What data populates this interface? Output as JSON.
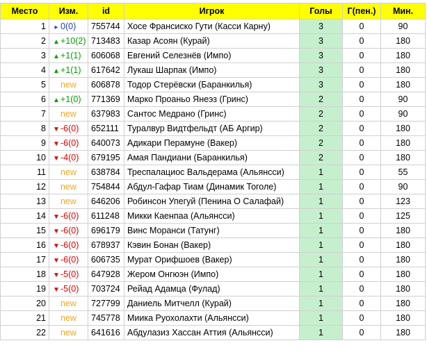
{
  "headers": {
    "rank": "Место",
    "change": "Изм.",
    "id": "id",
    "player": "Игрок",
    "goals": "Голы",
    "pen": "Г(пен.)",
    "min": "Мин."
  },
  "colors": {
    "header_bg": "#ffff00",
    "goals_bg": "#c6efce",
    "up": "#00a000",
    "down": "#e00000",
    "same": "#1f3fbf",
    "new": "#f5a623"
  },
  "rows": [
    {
      "rank": "1",
      "change_type": "same",
      "change": "0(0)",
      "id": "755744",
      "player": "Хосе Франсиско Гути (Касси Карну)",
      "goals": "3",
      "pen": "0",
      "min": "90"
    },
    {
      "rank": "2",
      "change_type": "up",
      "change": "+10(2)",
      "id": "713483",
      "player": "Казар Асоян (Курай)",
      "goals": "3",
      "pen": "0",
      "min": "180"
    },
    {
      "rank": "3",
      "change_type": "up",
      "change": "+1(1)",
      "id": "606068",
      "player": "Евгений Селезнёв (Импо)",
      "goals": "3",
      "pen": "0",
      "min": "180"
    },
    {
      "rank": "4",
      "change_type": "up",
      "change": "+1(1)",
      "id": "617642",
      "player": "Лукаш Шарпак (Импо)",
      "goals": "3",
      "pen": "0",
      "min": "180"
    },
    {
      "rank": "5",
      "change_type": "new",
      "change": "new",
      "id": "606878",
      "player": "Тодор Стерёвски (Баранкилья)",
      "goals": "3",
      "pen": "0",
      "min": "180"
    },
    {
      "rank": "6",
      "change_type": "up",
      "change": "+1(0)",
      "id": "771369",
      "player": "Марко Проаньо Янеэз (Гринс)",
      "goals": "2",
      "pen": "0",
      "min": "90"
    },
    {
      "rank": "7",
      "change_type": "new",
      "change": "new",
      "id": "637983",
      "player": "Сантос Медрано (Гринс)",
      "goals": "2",
      "pen": "0",
      "min": "90"
    },
    {
      "rank": "8",
      "change_type": "down",
      "change": "-6(0)",
      "id": "652111",
      "player": "Туралвур Видтфельдт (АБ Аргир)",
      "goals": "2",
      "pen": "0",
      "min": "180"
    },
    {
      "rank": "9",
      "change_type": "down",
      "change": "-6(0)",
      "id": "640073",
      "player": "Адикари Перамуне (Вакер)",
      "goals": "2",
      "pen": "0",
      "min": "180"
    },
    {
      "rank": "10",
      "change_type": "down",
      "change": "-4(0)",
      "id": "679195",
      "player": "Амая Пандиани (Баранкилья)",
      "goals": "2",
      "pen": "0",
      "min": "180"
    },
    {
      "rank": "11",
      "change_type": "new",
      "change": "new",
      "id": "638784",
      "player": "Треспалациос Вальдерама (Альянсси)",
      "goals": "1",
      "pen": "0",
      "min": "55"
    },
    {
      "rank": "12",
      "change_type": "new",
      "change": "new",
      "id": "754844",
      "player": "Абдул-Гафар Тиам (Динамик Тоголе)",
      "goals": "1",
      "pen": "0",
      "min": "90"
    },
    {
      "rank": "13",
      "change_type": "new",
      "change": "new",
      "id": "646206",
      "player": "Робинсон Упегуй (Пенина О Салафай)",
      "goals": "1",
      "pen": "0",
      "min": "123"
    },
    {
      "rank": "14",
      "change_type": "down",
      "change": "-6(0)",
      "id": "611248",
      "player": "Микки Каенпаа (Альянсси)",
      "goals": "1",
      "pen": "0",
      "min": "125"
    },
    {
      "rank": "15",
      "change_type": "down",
      "change": "-6(0)",
      "id": "696179",
      "player": "Винс Моранси (Татунг)",
      "goals": "1",
      "pen": "0",
      "min": "180"
    },
    {
      "rank": "16",
      "change_type": "down",
      "change": "-6(0)",
      "id": "678937",
      "player": "Кэвин Бонан (Вакер)",
      "goals": "1",
      "pen": "0",
      "min": "180"
    },
    {
      "rank": "17",
      "change_type": "down",
      "change": "-6(0)",
      "id": "606735",
      "player": "Мурат Орифшоев (Вакер)",
      "goals": "1",
      "pen": "0",
      "min": "180"
    },
    {
      "rank": "18",
      "change_type": "down",
      "change": "-5(0)",
      "id": "647928",
      "player": "Жером Онгюэн (Импо)",
      "goals": "1",
      "pen": "0",
      "min": "180"
    },
    {
      "rank": "19",
      "change_type": "down",
      "change": "-5(0)",
      "id": "703724",
      "player": "Рейад Адамца (Фулад)",
      "goals": "1",
      "pen": "0",
      "min": "180"
    },
    {
      "rank": "20",
      "change_type": "new",
      "change": "new",
      "id": "727799",
      "player": "Даниель Митчелл (Курай)",
      "goals": "1",
      "pen": "0",
      "min": "180"
    },
    {
      "rank": "21",
      "change_type": "new",
      "change": "new",
      "id": "745778",
      "player": "Миика Руохолахти (Альянсси)",
      "goals": "1",
      "pen": "0",
      "min": "180"
    },
    {
      "rank": "22",
      "change_type": "new",
      "change": "new",
      "id": "641616",
      "player": "Абдулазиз Хассан Аттия (Альянсси)",
      "goals": "1",
      "pen": "0",
      "min": "180"
    }
  ]
}
